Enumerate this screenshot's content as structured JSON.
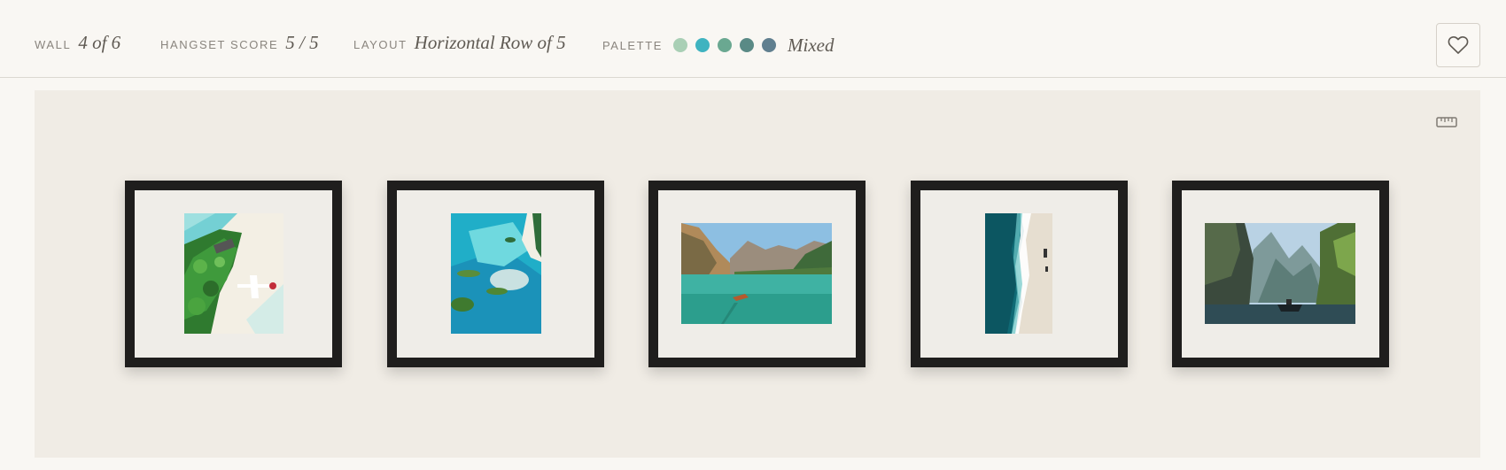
{
  "header": {
    "wall": {
      "label": "WALL",
      "value": "4 of 6"
    },
    "score": {
      "label": "HANGSET SCORE",
      "value": "5 / 5"
    },
    "layout": {
      "label": "LAYOUT",
      "value": "Horizontal Row of 5"
    },
    "palette": {
      "label": "PALETTE",
      "value": "Mixed",
      "swatches": [
        "#a9cfb5",
        "#3fb3c0",
        "#6aa891",
        "#5a8a86",
        "#607f8f"
      ]
    },
    "favorite_icon": "heart-icon"
  },
  "wall": {
    "tool_icon": "ruler-icon",
    "artworks": [
      {
        "name": "tropical-beach-seaplane-photo",
        "orientation": "portrait"
      },
      {
        "name": "turquoise-lagoon-islands-photo",
        "orientation": "portrait"
      },
      {
        "name": "alpine-lake-boat-photo",
        "orientation": "landscape"
      },
      {
        "name": "aerial-ocean-shoreline-photo",
        "orientation": "portrait"
      },
      {
        "name": "karst-cliffs-lake-boat-photo",
        "orientation": "landscape"
      }
    ]
  }
}
